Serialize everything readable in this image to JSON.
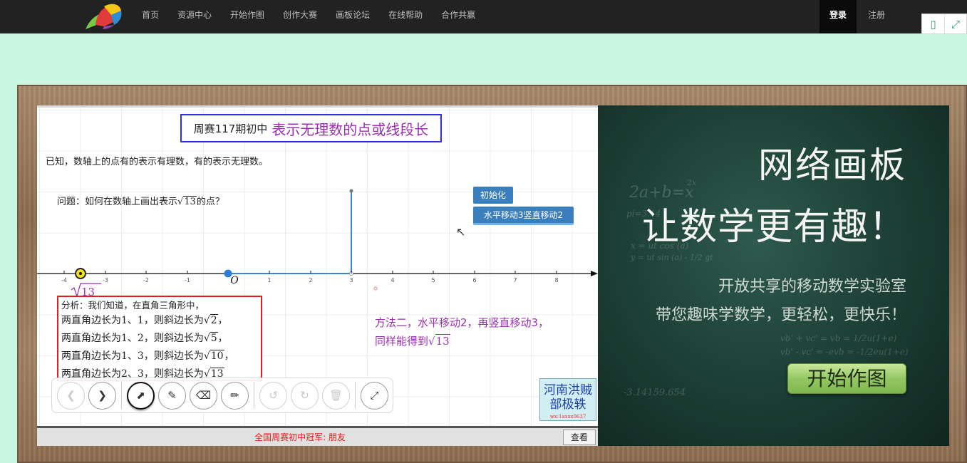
{
  "nav": {
    "items": [
      "首页",
      "资源中心",
      "开始作图",
      "创作大赛",
      "画板论坛",
      "在线帮助",
      "合作共赢"
    ],
    "login": "登录",
    "register": "注册"
  },
  "board": {
    "title_small": "周赛117期初中",
    "title_big": "表示无理数的点或线段长",
    "known": "已知，数轴上的点有的表示有理数，有的表示无理数。",
    "question_prefix": "问题：如何在数轴上画出表示",
    "question_radicand": "13",
    "question_suffix": "的点？",
    "btn_init": "初始化",
    "btn_move": "水平移动3竖直移动2",
    "axis_ticks": [
      "-4",
      "-3",
      "-2",
      "-1",
      "O",
      "1",
      "2",
      "3",
      "4",
      "5",
      "6",
      "7",
      "8"
    ],
    "point_label_radicand": "13",
    "analysis_intro": "分析：我们知道，在直角三角形中，",
    "analysis_lines": [
      {
        "text": "两直角边长为1、1，则斜边长为",
        "radicand": "2",
        "end": "，"
      },
      {
        "text": "两直角边长为1、2，则斜边长为",
        "radicand": "5",
        "end": "，"
      },
      {
        "text": "两直角边长为1、3，则斜边长为",
        "radicand": "10",
        "end": "，"
      },
      {
        "text": "两直角边长为2、3，则斜边长为",
        "radicand": "13",
        "end": ""
      }
    ],
    "method2_line1": "方法二，水平移动2，再竖直移动3，",
    "method2_line2": "同样能得到",
    "method2_radicand": "13",
    "stamp_text": "河南洪贼",
    "stamp_text2": "部极轶",
    "stamp_small": "wx:1axxx0637"
  },
  "status": {
    "text": "全国周赛初中冠军: 朋友",
    "view_label": "查看"
  },
  "chalkboard": {
    "headline1": "网络画板",
    "headline2": "让数学更有趣！",
    "sub1": "开放共享的移动数学实验室",
    "sub2": "带您趣味学数学，更轻松，更快乐！",
    "button": "开始作图",
    "doodles": [
      "2a+b=x",
      "pi=3.14",
      "x = ut cos (a)",
      "y = ut sin (a) - 1/2 gt",
      "vb' + vc' = vb = 1/2u(1+e)",
      "vb' - vc' = -evb = -1/2eu(1+e)",
      "-3.14159.654",
      "2x"
    ]
  }
}
